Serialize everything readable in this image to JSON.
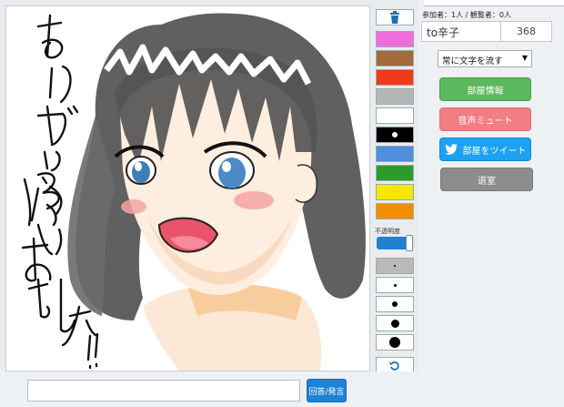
{
  "canvas": {
    "drawing_text_lines": [
      "ありがとう",
      "ございました!!"
    ]
  },
  "palette": {
    "colors": [
      "#ee6fdc",
      "#a36a3b",
      "#f03a17",
      "#b5b5b5",
      "#ffffff",
      "#000000",
      "#4d8fdb",
      "#2d9b2c",
      "#f6e700",
      "#f18d00"
    ],
    "selected_color": "#000000",
    "opacity_label": "不透明度",
    "opacity_value": 0.85
  },
  "sidebar": {
    "participants": "参加者：1人 / 観覧者：0人",
    "user_name": "to辛子",
    "user_score": "368",
    "text_mode_select": "常に文字を流す",
    "room_info_button": "部屋情報",
    "mute_button": "音声ミュート",
    "tweet_button": "部屋をツイート",
    "exit_button": "退室"
  },
  "chat": {
    "input_value": "",
    "submit_button": "回答/発言"
  }
}
